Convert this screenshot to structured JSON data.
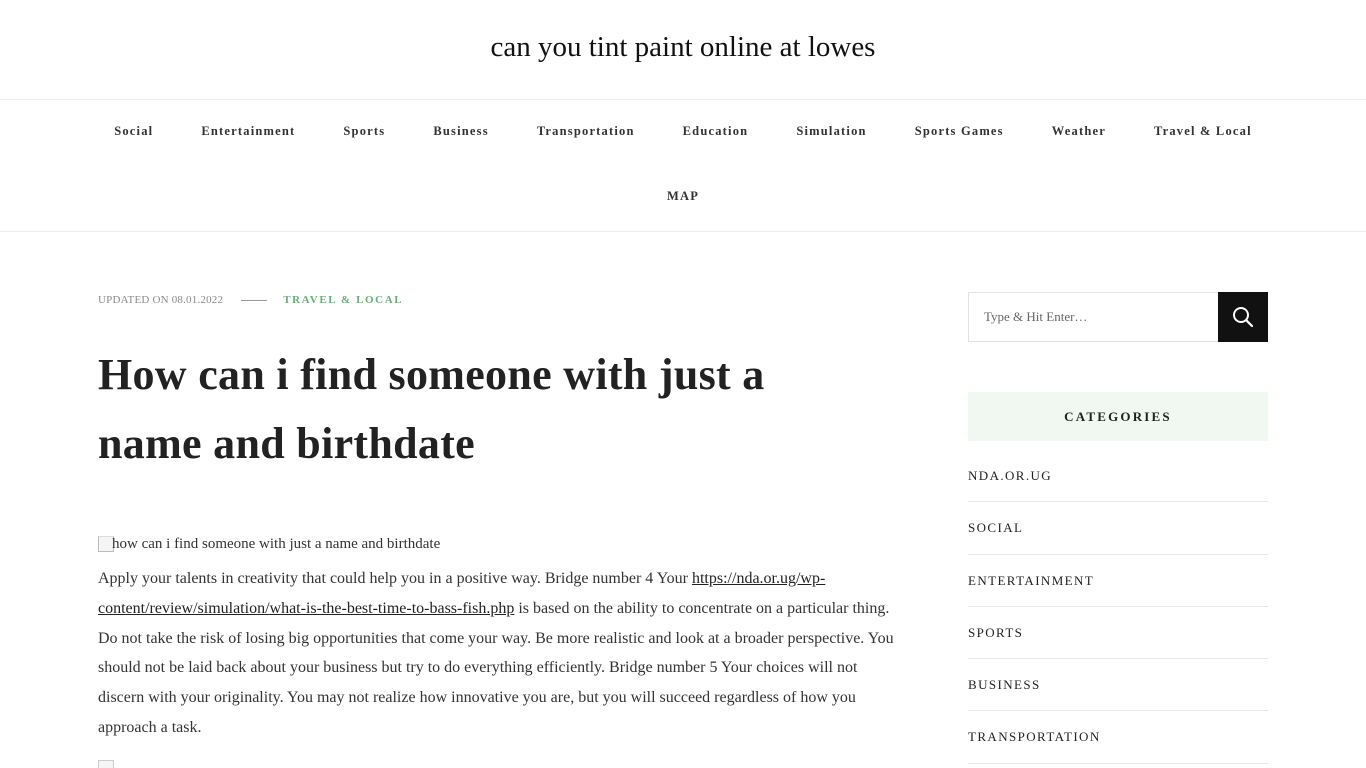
{
  "site": {
    "title": "can you tint paint online at lowes"
  },
  "nav": {
    "row1": [
      "Social",
      "Entertainment",
      "Sports",
      "Business",
      "Transportation",
      "Education",
      "Simulation",
      "Sports Games",
      "Weather",
      "Travel & Local"
    ],
    "row2": [
      "MAP"
    ]
  },
  "post": {
    "updated": "UPDATED ON 08.01.2022",
    "category": "TRAVEL & LOCAL",
    "title": "How can i find someone with just a name and birthdate",
    "image_alt": "how can i find someone with just a name and birthdate",
    "text_before_link": "Apply your talents in creativity that could help you in a positive way. Bridge number 4 Your ",
    "link_text": "https://nda.or.ug/wp-content/review/simulation/what-is-the-best-time-to-bass-fish.php",
    "text_after_link": " is based on the ability to concentrate on a particular thing. Do not take the risk of losing big opportunities that come your way. Be more realistic and look at a broader perspective. You should not be laid back about your business but try to do everything efficiently. Bridge number 5 Your choices will not discern with your originality. You may not realize how innovative you are, but you will succeed regardless of how you approach a task."
  },
  "sidebar": {
    "search_placeholder": "Type & Hit Enter…",
    "search_icon": "search-icon",
    "categories_title": "CATEGORIES",
    "categories": [
      "NDA.OR.UG",
      "SOCIAL",
      "ENTERTAINMENT",
      "SPORTS",
      "BUSINESS",
      "TRANSPORTATION"
    ]
  },
  "colors": {
    "accent": "#6aae78",
    "category_bg": "#f1f8f2",
    "search_button": "#111111"
  }
}
